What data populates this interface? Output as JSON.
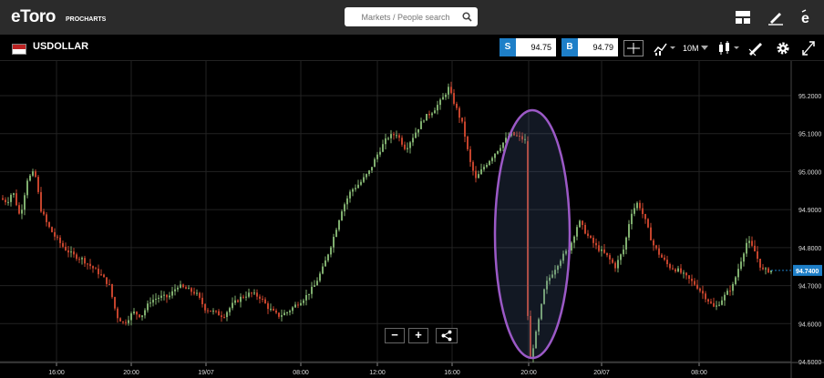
{
  "header": {
    "logo_text": "eToro",
    "logo_sub": "PROCHARTS",
    "search_placeholder": "Markets / People search",
    "icons": [
      "layout-icon",
      "pencil-icon",
      "etoro-e-icon"
    ]
  },
  "instrument": {
    "symbol": "USDOLLAR",
    "sell_label": "S",
    "sell_price": "94.75",
    "buy_label": "B",
    "buy_price": "94.79",
    "interval": "10M"
  },
  "colors": {
    "up": "#7fae6e",
    "down": "#c4432c",
    "accent": "#1e7fc8",
    "highlight_ellipse": "#9b59c6"
  },
  "chart_data": {
    "type": "candlestick",
    "y_ticks": [
      "95.2000",
      "95.1000",
      "95.0000",
      "94.9000",
      "94.8000",
      "94.7000",
      "94.6000",
      "94.5000"
    ],
    "current_price": "94.7400",
    "x_ticks": [
      "16:00",
      "20:00",
      "19/07",
      "08:00",
      "12:00",
      "16:00",
      "20:00",
      "20/07",
      "08:00"
    ],
    "ylim": [
      94.5,
      95.2
    ],
    "close_path": [
      [
        0,
        94.93
      ],
      [
        8,
        94.92
      ],
      [
        14,
        94.95
      ],
      [
        22,
        94.88
      ],
      [
        30,
        94.98
      ],
      [
        38,
        95.0
      ],
      [
        45,
        94.9
      ],
      [
        52,
        94.86
      ],
      [
        60,
        94.83
      ],
      [
        70,
        94.8
      ],
      [
        80,
        94.78
      ],
      [
        90,
        94.77
      ],
      [
        100,
        94.75
      ],
      [
        110,
        94.73
      ],
      [
        120,
        94.7
      ],
      [
        128,
        94.62
      ],
      [
        136,
        94.6
      ],
      [
        146,
        94.63
      ],
      [
        155,
        94.62
      ],
      [
        165,
        94.66
      ],
      [
        175,
        94.67
      ],
      [
        185,
        94.67
      ],
      [
        195,
        94.7
      ],
      [
        205,
        94.69
      ],
      [
        215,
        94.68
      ],
      [
        225,
        94.64
      ],
      [
        235,
        94.63
      ],
      [
        245,
        94.62
      ],
      [
        255,
        94.65
      ],
      [
        265,
        94.67
      ],
      [
        275,
        94.68
      ],
      [
        285,
        94.67
      ],
      [
        295,
        94.64
      ],
      [
        305,
        94.62
      ],
      [
        315,
        94.63
      ],
      [
        325,
        94.65
      ],
      [
        335,
        94.67
      ],
      [
        345,
        94.7
      ],
      [
        355,
        94.75
      ],
      [
        365,
        94.82
      ],
      [
        375,
        94.9
      ],
      [
        385,
        94.95
      ],
      [
        395,
        94.97
      ],
      [
        405,
        95.0
      ],
      [
        415,
        95.05
      ],
      [
        425,
        95.09
      ],
      [
        435,
        95.1
      ],
      [
        445,
        95.06
      ],
      [
        455,
        95.1
      ],
      [
        465,
        95.14
      ],
      [
        475,
        95.16
      ],
      [
        485,
        95.19
      ],
      [
        492,
        95.22
      ],
      [
        500,
        95.17
      ],
      [
        508,
        95.12
      ],
      [
        515,
        95.03
      ],
      [
        522,
        94.98
      ],
      [
        530,
        95.01
      ],
      [
        540,
        95.04
      ],
      [
        550,
        95.07
      ],
      [
        560,
        95.1
      ],
      [
        570,
        95.09
      ],
      [
        578,
        95.08
      ],
      [
        581,
        94.5
      ],
      [
        586,
        94.55
      ],
      [
        592,
        94.62
      ],
      [
        598,
        94.7
      ],
      [
        605,
        94.73
      ],
      [
        615,
        94.77
      ],
      [
        625,
        94.8
      ],
      [
        635,
        94.87
      ],
      [
        645,
        94.83
      ],
      [
        655,
        94.8
      ],
      [
        665,
        94.78
      ],
      [
        675,
        94.75
      ],
      [
        685,
        94.8
      ],
      [
        692,
        94.89
      ],
      [
        700,
        94.92
      ],
      [
        708,
        94.87
      ],
      [
        716,
        94.81
      ],
      [
        724,
        94.78
      ],
      [
        734,
        94.75
      ],
      [
        744,
        94.74
      ],
      [
        754,
        94.72
      ],
      [
        764,
        94.7
      ],
      [
        774,
        94.67
      ],
      [
        784,
        94.64
      ],
      [
        794,
        94.67
      ],
      [
        804,
        94.7
      ],
      [
        812,
        94.76
      ],
      [
        820,
        94.82
      ],
      [
        828,
        94.79
      ],
      [
        836,
        94.74
      ],
      [
        846,
        94.74
      ]
    ]
  }
}
